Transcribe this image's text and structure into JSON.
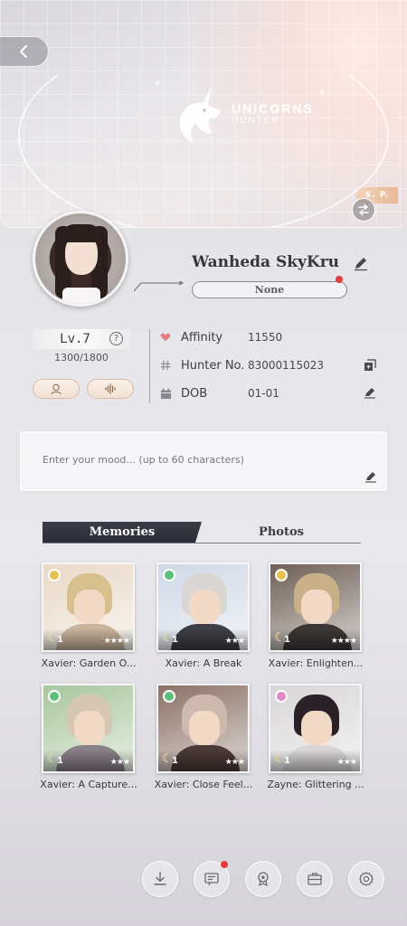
{
  "banner": {
    "logo_title": "UNICORNS",
    "logo_subtitle": "HUNTER",
    "sp_badge": "S. P."
  },
  "profile": {
    "name": "Wanheda SkyKru",
    "title_label": "None",
    "level": "Lv.7",
    "exp": "1300/1800"
  },
  "info": {
    "affinity_label": "Affinity",
    "affinity_value": "11550",
    "hunter_label": "Hunter No.",
    "hunter_value": "83000115023",
    "dob_label": "DOB",
    "dob_value": "01-01"
  },
  "mood": {
    "placeholder": "Enter your mood... (up to 60 characters)"
  },
  "tabs": {
    "memories": "Memories",
    "photos": "Photos"
  },
  "cards": [
    {
      "name": "Xavier: Garden O...",
      "level": "1",
      "stars": "★★★★",
      "medal_color": "#e8c24e",
      "bg": "#e9d9c8",
      "hair": "#d8c08e",
      "body": "#c9b49c"
    },
    {
      "name": "Xavier: A Break",
      "level": "1",
      "stars": "★★★",
      "medal_color": "#5cc07a",
      "bg": "#cfd8e6",
      "hair": "#d9d7d4",
      "body": "#3e3e46"
    },
    {
      "name": "Xavier: Enlighten...",
      "level": "1",
      "stars": "★★★★",
      "medal_color": "#e8c24e",
      "bg": "#6e5f55",
      "hair": "#c9b089",
      "body": "#3c3636"
    },
    {
      "name": "Xavier: A Capture...",
      "level": "1",
      "stars": "★★★",
      "medal_color": "#5cc07a",
      "bg": "#a9c69e",
      "hair": "#d6c7b4",
      "body": "#8a8088"
    },
    {
      "name": "Xavier: Close Feel...",
      "level": "1",
      "stars": "★★★",
      "medal_color": "#5cc07a",
      "bg": "#8a7166",
      "hair": "#cdb9ad",
      "body": "#4a3a37"
    },
    {
      "name": "Zayne: Glittering ...",
      "level": "1",
      "stars": "★★★",
      "medal_color": "#e58ac9",
      "bg": "#d8d5d6",
      "hair": "#2a2228",
      "body": "#d9d6d8"
    }
  ],
  "colors": {
    "accent_peach": "#f1e1d2",
    "tab_dark": "#2b2d36",
    "notification_red": "#e53a3a",
    "affinity_heart": "#e77b85"
  },
  "icons": {
    "nav": [
      "download-icon",
      "message-icon",
      "badge-icon",
      "briefcase-icon",
      "settings-icon"
    ]
  }
}
